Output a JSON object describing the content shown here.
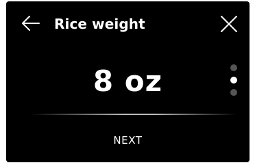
{
  "header": {
    "title": "Rice weight",
    "back_icon": "arrow-left-icon",
    "close_icon": "close-icon"
  },
  "main": {
    "value": "8 oz"
  },
  "pager": {
    "total": 3,
    "active_index": 1
  },
  "footer": {
    "next_label": "NEXT"
  },
  "colors": {
    "background": "#000000",
    "text": "#ffffff",
    "dot_inactive": "#555555",
    "dot_active": "#ffffff"
  }
}
